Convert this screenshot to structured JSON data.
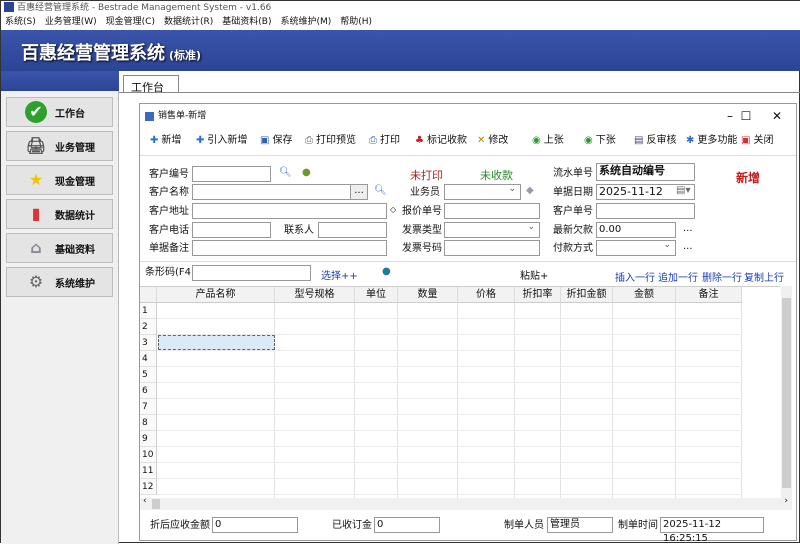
{
  "app": {
    "title": "百惠经营管理系统 - Bestrade Management System - v1.66",
    "banner_title": "百惠经营管理系统",
    "banner_edition": "(标准)"
  },
  "menu": [
    "系统(S)",
    "业务管理(W)",
    "现金管理(C)",
    "数据统计(R)",
    "基础资料(B)",
    "系统维护(M)",
    "帮助(H)"
  ],
  "sidebar": [
    {
      "label": "工作台",
      "icon": "check-icon"
    },
    {
      "label": "业务管理",
      "icon": "printer-icon"
    },
    {
      "label": "现金管理",
      "icon": "star-icon"
    },
    {
      "label": "数据统计",
      "icon": "bar-chart-icon"
    },
    {
      "label": "基础资料",
      "icon": "tag-icon"
    },
    {
      "label": "系统维护",
      "icon": "gear-icon"
    }
  ],
  "tab": "工作台",
  "window": {
    "title": "销售单-新增"
  },
  "toolbar": [
    {
      "label": "新增",
      "icon": "plus-icon"
    },
    {
      "label": "引入新增",
      "icon": "plus-icon"
    },
    {
      "label": "保存",
      "icon": "save-icon"
    },
    {
      "label": "打印预览",
      "icon": "print-preview-icon"
    },
    {
      "label": "打印",
      "icon": "print-icon"
    },
    {
      "label": "标记收款",
      "icon": "mark-paid-icon"
    },
    {
      "label": "修改",
      "icon": "edit-icon"
    },
    {
      "label": "上张",
      "icon": "arrow-up-icon"
    },
    {
      "label": "下张",
      "icon": "arrow-down-icon"
    },
    {
      "label": "反审核",
      "icon": "unapprove-icon"
    },
    {
      "label": "更多功能",
      "icon": "more-icon"
    },
    {
      "label": "关闭",
      "icon": "close-icon"
    }
  ],
  "form": {
    "customer_no": {
      "label": "客户编号",
      "value": ""
    },
    "customer_name": {
      "label": "客户名称",
      "value": ""
    },
    "customer_addr": {
      "label": "客户地址",
      "value": ""
    },
    "customer_phone": {
      "label": "客户电话",
      "value": ""
    },
    "contact": {
      "label": "联系人",
      "value": ""
    },
    "remark": {
      "label": "单据备注",
      "value": ""
    },
    "print_status": "未打印",
    "pay_status": "未收款",
    "salesman": {
      "label": "业务员",
      "value": ""
    },
    "quote_no": {
      "label": "报价单号",
      "value": ""
    },
    "invoice_type": {
      "label": "发票类型",
      "value": ""
    },
    "invoice_no": {
      "label": "发票号码",
      "value": ""
    },
    "serial_no": {
      "label": "流水单号",
      "value": "系统自动编号"
    },
    "doc_date": {
      "label": "单据日期",
      "value": "2025-11-12"
    },
    "cust_order_no": {
      "label": "客户单号",
      "value": ""
    },
    "latest_debt": {
      "label": "最新欠款",
      "value": "0.00"
    },
    "pay_method": {
      "label": "付款方式",
      "value": ""
    },
    "mode": "新增",
    "ellipsis": "..."
  },
  "barcode": {
    "label": "条形码(F4)",
    "value": "",
    "select": "选择++",
    "paste": "粘贴+"
  },
  "row_actions": [
    "插入一行",
    "追加一行",
    "删除一行",
    "复制上行"
  ],
  "grid": {
    "columns": [
      "产品名称",
      "型号规格",
      "单位",
      "数量",
      "价格",
      "折扣率",
      "折扣金额",
      "金额",
      "备注"
    ],
    "rows": [
      "1",
      "2",
      "3",
      "4",
      "5",
      "6",
      "7",
      "8",
      "9",
      "10",
      "11",
      "12"
    ]
  },
  "footer": {
    "net_label": "折后应收金额",
    "net": "0",
    "deposit_label": "已收订金",
    "deposit": "0",
    "maker_label": "制单人员",
    "maker": "管理员",
    "time_label": "制单时间",
    "time": "2025-11-12 16:25:15"
  },
  "colors": {
    "banner": "#2f4aa0",
    "status_red": "#b02020",
    "status_green": "#2a8a2a",
    "link": "#1a3fb0"
  }
}
